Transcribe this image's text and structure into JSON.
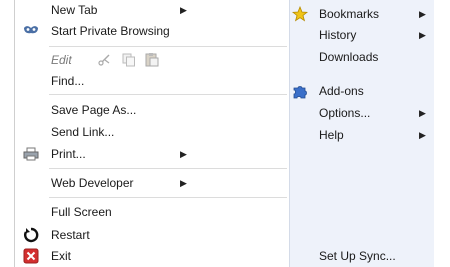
{
  "left_menu": {
    "new_tab": "New Tab",
    "private_browsing": "Start Private Browsing",
    "edit": "Edit",
    "find": "Find...",
    "save_page": "Save Page As...",
    "send_link": "Send Link...",
    "print": "Print...",
    "web_developer": "Web Developer",
    "full_screen": "Full Screen",
    "restart": "Restart",
    "exit": "Exit"
  },
  "right_menu": {
    "bookmarks": "Bookmarks",
    "history": "History",
    "downloads": "Downloads",
    "addons": "Add-ons",
    "options": "Options...",
    "help": "Help",
    "setup_sync": "Set Up Sync..."
  },
  "colors": {
    "right_pane_bg": "#eef2fa",
    "separator": "#dcdcdc",
    "star": "#f0c419",
    "puzzle": "#3a6fc9",
    "exit_red": "#d32f2f"
  }
}
